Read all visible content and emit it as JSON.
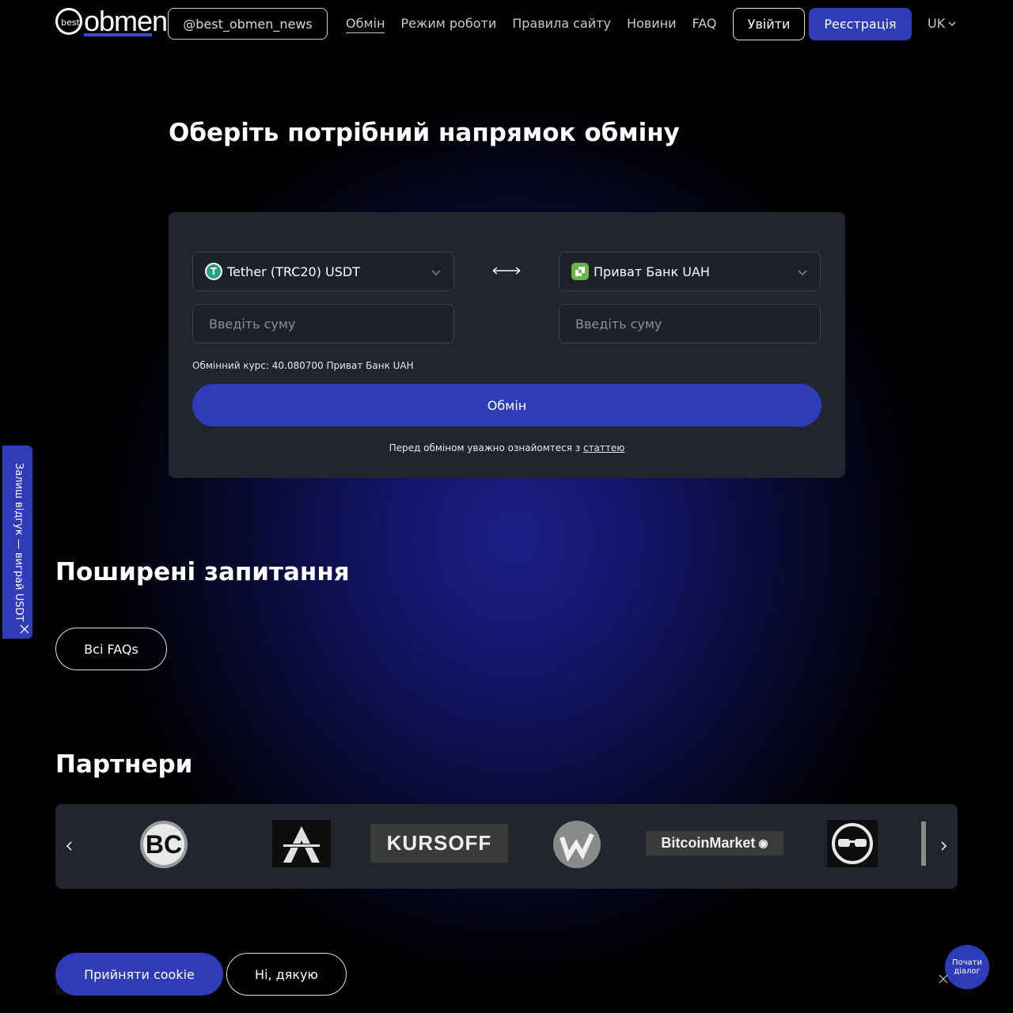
{
  "header": {
    "logo_small": "best",
    "logo_main": "obmen",
    "telegram_label": "@best_obmen_news",
    "nav": [
      {
        "label": "Обмін",
        "active": true
      },
      {
        "label": "Режим роботи",
        "active": false
      },
      {
        "label": "Правила сайту",
        "active": false
      },
      {
        "label": "Новини",
        "active": false
      },
      {
        "label": "FAQ",
        "active": false
      }
    ],
    "login_label": "Увійти",
    "register_label": "Реєстрація",
    "language": "UK"
  },
  "exchange": {
    "title": "Оберіть потрібний напрямок обміну",
    "from_currency": "Tether (TRC20) USDT",
    "to_currency": "Приват Банк UAH",
    "from_amount_placeholder": "Введіть суму",
    "to_amount_placeholder": "Введіть суму",
    "rate_text": "Обмінний курс: 40.080700 Приват Банк UAH",
    "exchange_button": "Обмін",
    "note_text": "Перед обміном уважно ознайомтеся з ",
    "note_link": "статтею"
  },
  "feedback_tab": {
    "label": "Залиш відгук — виграй USDT"
  },
  "faq": {
    "title": "Поширені запитання",
    "all_button": "Всі FAQs"
  },
  "partners": {
    "title": "Партнери",
    "logos": [
      "BC",
      "A",
      "KURSOFF",
      "W",
      "BitcoinMarket",
      "glasses"
    ],
    "kursoff_text": "KURSOFF",
    "bitcoinmarket_text": "BitcoinMarket"
  },
  "cookie": {
    "accept_label": "Прийняти cookie",
    "decline_label": "Ні, дякую"
  },
  "chat": {
    "label_line1": "Почати",
    "label_line2": "діалог"
  },
  "colors": {
    "accent": "#2f3cb8",
    "card": "#22252e",
    "tether": "#26a17b",
    "privat": "#6cb33f"
  }
}
